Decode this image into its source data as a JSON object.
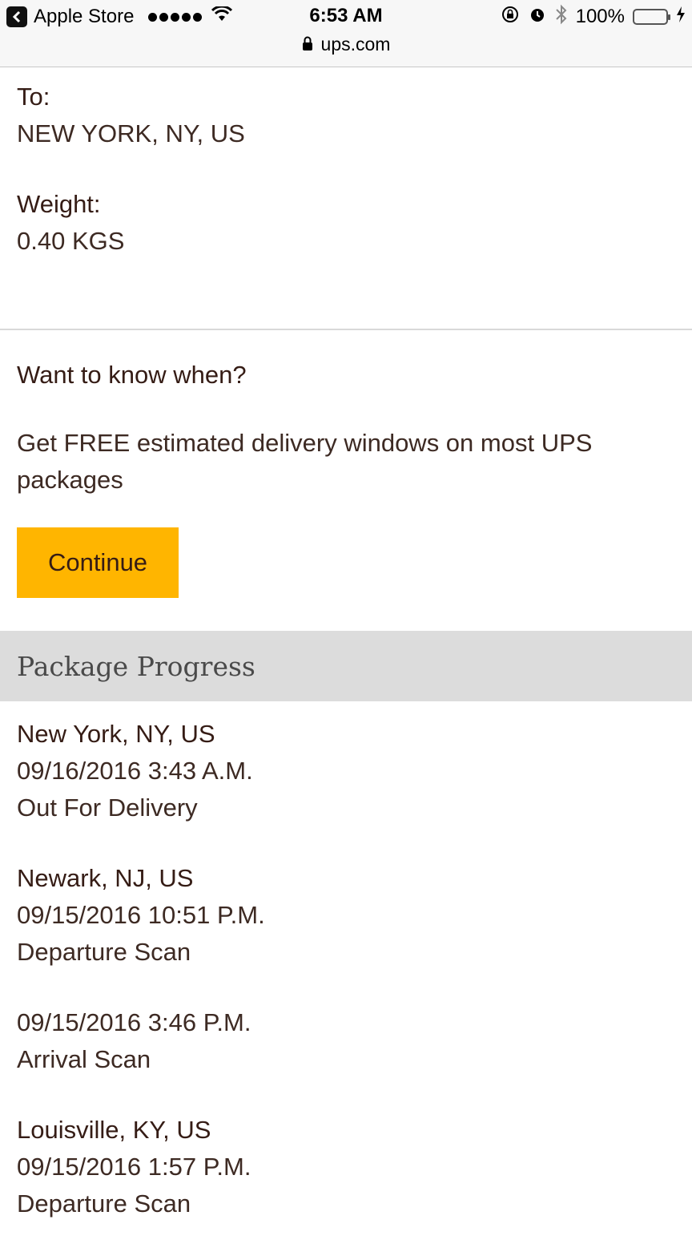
{
  "status_bar": {
    "back_app": "Apple Store",
    "time": "6:53 AM",
    "url": "ups.com",
    "battery": "100%",
    "battery_level": 1.0
  },
  "shipment": {
    "to_label": "To:",
    "to_value": "NEW YORK, NY, US",
    "weight_label": "Weight:",
    "weight_value": "0.40 KGS"
  },
  "cta": {
    "title": "Want to know when?",
    "description": "Get FREE estimated delivery windows on most UPS packages",
    "button_label": "Continue",
    "button_color": "#ffb500"
  },
  "progress": {
    "heading": "Package Progress",
    "events": [
      {
        "location": "New York, NY, US",
        "datetime": "09/16/2016 3:43 A.M.",
        "status": "Out For Delivery"
      },
      {
        "location": "Newark, NJ, US",
        "datetime": "09/15/2016 10:51 P.M.",
        "status": "Departure Scan"
      },
      {
        "location": "",
        "datetime": "09/15/2016 3:46 P.M.",
        "status": "Arrival Scan"
      },
      {
        "location": "Louisville, KY, US",
        "datetime": "09/15/2016 1:57 P.M.",
        "status": "Departure Scan"
      }
    ]
  }
}
